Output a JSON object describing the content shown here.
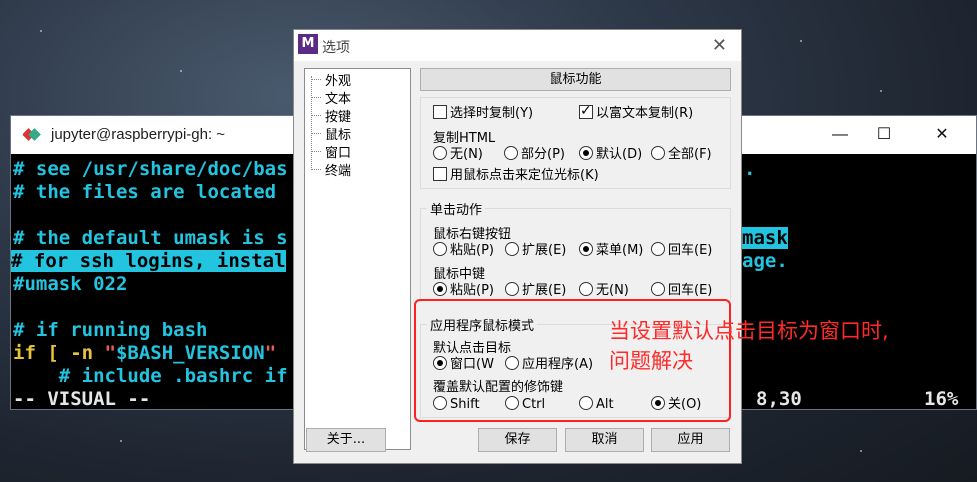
{
  "terminal": {
    "title": "jupyter@raspberrypi-gh: ~",
    "minimize_glyph": "—",
    "maximize_glyph": "☐",
    "close_glyph": "✕",
    "lines": [
      "# see /usr/share/doc/bas",
      "# the files are located",
      "",
      "# the default umask is s",
      "# for ssh logins, instal",
      "#umask 022",
      "",
      "# if running bash",
      "if [ -n \"$BASH_VERSION\"",
      "    # include .bashrc if"
    ],
    "right_fragments": {
      "line1": ".",
      "umask": "mask",
      "usage": "age."
    },
    "status_mode": "-- VISUAL --",
    "status_position": "8,30",
    "status_percent": "16%",
    "cyan_color": "#23c4e0"
  },
  "dialog": {
    "title": "选项",
    "icon_letter": "M",
    "close_glyph": "✕",
    "tree_items": [
      "外观",
      "文本",
      "按键",
      "鼠标",
      "窗口",
      "终端"
    ],
    "panel_title": "鼠标功能",
    "copy_on_select": "选择时复制(Y)",
    "rich_text_copy": "以富文本复制(R)",
    "copy_html_label": "复制HTML",
    "copy_html_options": [
      "无(N)",
      "部分(P)",
      "默认(D)",
      "全部(F)"
    ],
    "copy_html_selected": "默认(D)",
    "click_position_cursor": "用鼠标点击来定位光标(K)",
    "single_click_group": "单击动作",
    "right_button_label": "鼠标右键按钮",
    "right_button_options": [
      "粘贴(P)",
      "扩展(E)",
      "菜单(M)",
      "回车(E)"
    ],
    "right_button_selected": "菜单(M)",
    "middle_button_label": "鼠标中键",
    "middle_button_options": [
      "粘贴(P)",
      "扩展(E)",
      "无(N)",
      "回车(E)"
    ],
    "middle_button_selected": "粘贴(P)",
    "app_mouse_group": "应用程序鼠标模式",
    "default_target_label": "默认点击目标",
    "default_target_options": [
      "窗口(W",
      "应用程序(A)"
    ],
    "default_target_selected": "窗口(W",
    "override_modifier_label": "覆盖默认配置的修饰键",
    "modifier_options": [
      "Shift",
      "Ctrl",
      "Alt",
      "关(O)"
    ],
    "modifier_selected": "关(O)",
    "about_button": "关于...",
    "save_button": "保存",
    "cancel_button": "取消",
    "apply_button": "应用"
  },
  "annotation": {
    "line1": "当设置默认点击目标为窗口时,",
    "line2": "问题解决",
    "color": "#ff2a2a"
  }
}
